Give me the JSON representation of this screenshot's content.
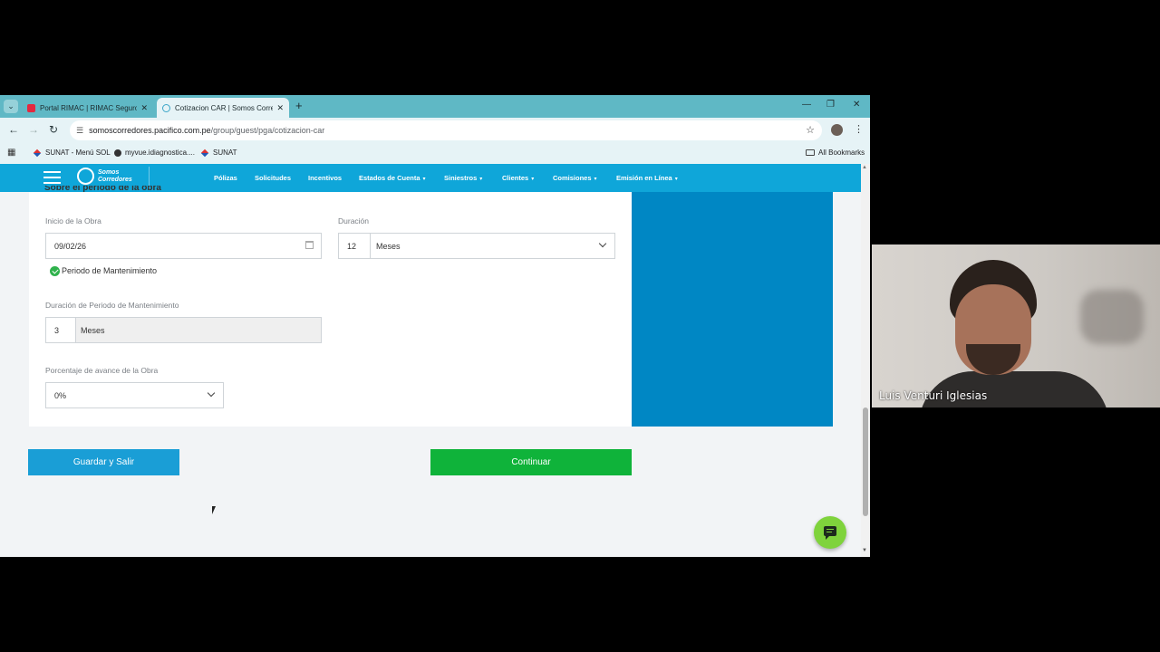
{
  "browser": {
    "tabs": [
      {
        "title": "Portal RIMAC | RIMAC Seguros",
        "active": false
      },
      {
        "title": "Cotizacion CAR | Somos Corred",
        "active": true
      }
    ],
    "url_host": "somoscorredores.pacifico.com.pe",
    "url_path": "/group/guest/pga/cotizacion-car",
    "bookmarks": [
      "SUNAT - Menú SOL",
      "myvue.idiagnostica....",
      "SUNAT"
    ],
    "all_bookmarks": "All Bookmarks"
  },
  "site": {
    "logo_line1": "Somos",
    "logo_line2": "Corredores",
    "menu": [
      {
        "label": "Pólizas",
        "dropdown": false
      },
      {
        "label": "Solicitudes",
        "dropdown": false
      },
      {
        "label": "Incentivos",
        "dropdown": false
      },
      {
        "label": "Estados de Cuenta",
        "dropdown": true
      },
      {
        "label": "Siniestros",
        "dropdown": true
      },
      {
        "label": "Clientes",
        "dropdown": true
      },
      {
        "label": "Comisiones",
        "dropdown": true
      },
      {
        "label": "Emisión en Línea",
        "dropdown": true
      }
    ],
    "dropdown_caret": "▾"
  },
  "form": {
    "section_heading": "Sobre el periodo de la obra",
    "inicio_label": "Inicio de la Obra",
    "inicio_value": "09/02/26",
    "duracion_label": "Duración",
    "duracion_value": "12",
    "duracion_unit": "Meses",
    "mantenimiento_checkbox": "Periodo de Mantenimiento",
    "mantenimiento_label": "Duración de Periodo de Mantenimiento",
    "mantenimiento_value": "3",
    "mantenimiento_unit": "Meses",
    "avance_label": "Porcentaje de avance de la Obra",
    "avance_value": "0%"
  },
  "actions": {
    "save_label": "Guardar y Salir",
    "continue_label": "Continuar"
  },
  "colors": {
    "nav_blue": "#0fa6d9",
    "panel_blue": "#0087c4",
    "save_blue": "#1a9ed6",
    "continue_green": "#0fb33a",
    "chat_green": "#7fd33c"
  },
  "webcam": {
    "participant_name": "Luis Venturi Iglesias"
  }
}
